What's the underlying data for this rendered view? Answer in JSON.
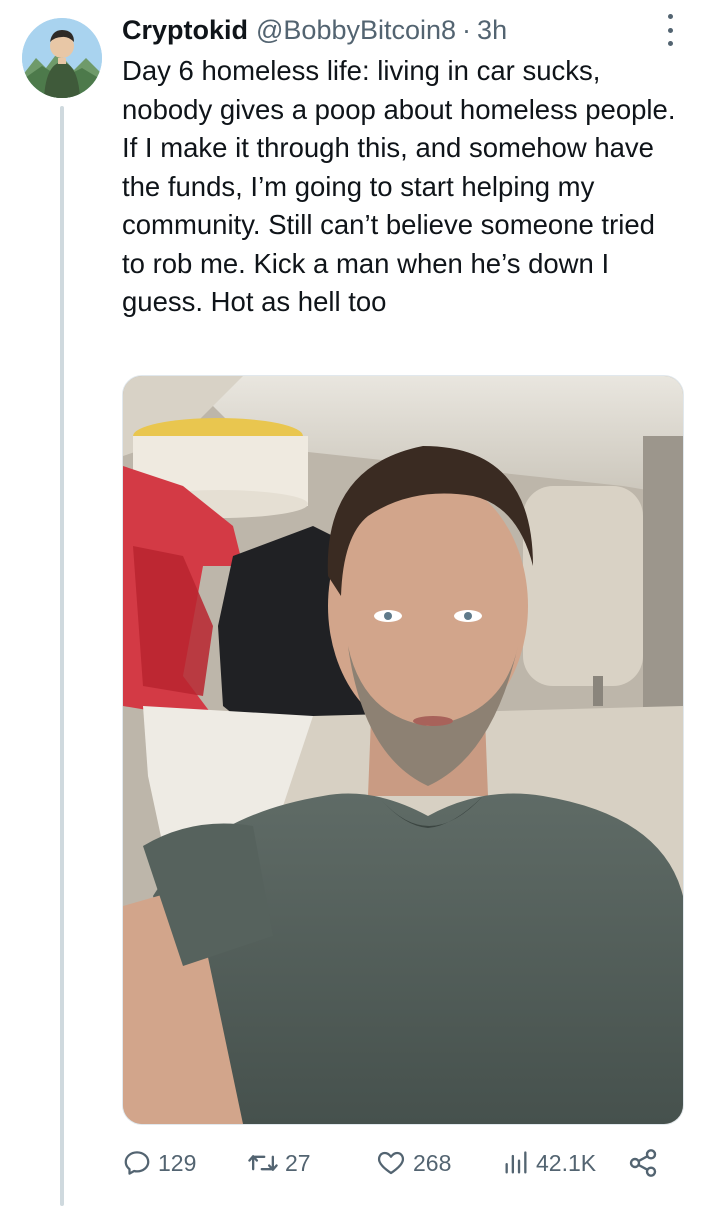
{
  "tweet": {
    "display_name": "Cryptokid",
    "handle": "@BobbyBitcoin8",
    "separator": "·",
    "time": "3h",
    "text": "Day 6 homeless life: living in car sucks, nobody gives a poop about homeless people. If I make it through this, and somehow have the funds, I’m going to start helping my community. Still can’t believe someone tried to rob me. Kick a man when he’s down I guess. Hot as hell too",
    "media": {
      "icon": "photo-selfie-in-car"
    }
  },
  "actions": {
    "reply": {
      "icon": "reply-icon",
      "count": "129"
    },
    "retweet": {
      "icon": "retweet-icon",
      "count": "27"
    },
    "like": {
      "icon": "heart-icon",
      "count": "268"
    },
    "views": {
      "icon": "views-icon",
      "count": "42.1K"
    },
    "share": {
      "icon": "share-icon"
    }
  },
  "colors": {
    "text": "#0f1419",
    "secondary": "#536471",
    "thread_line": "#cfd9de"
  }
}
